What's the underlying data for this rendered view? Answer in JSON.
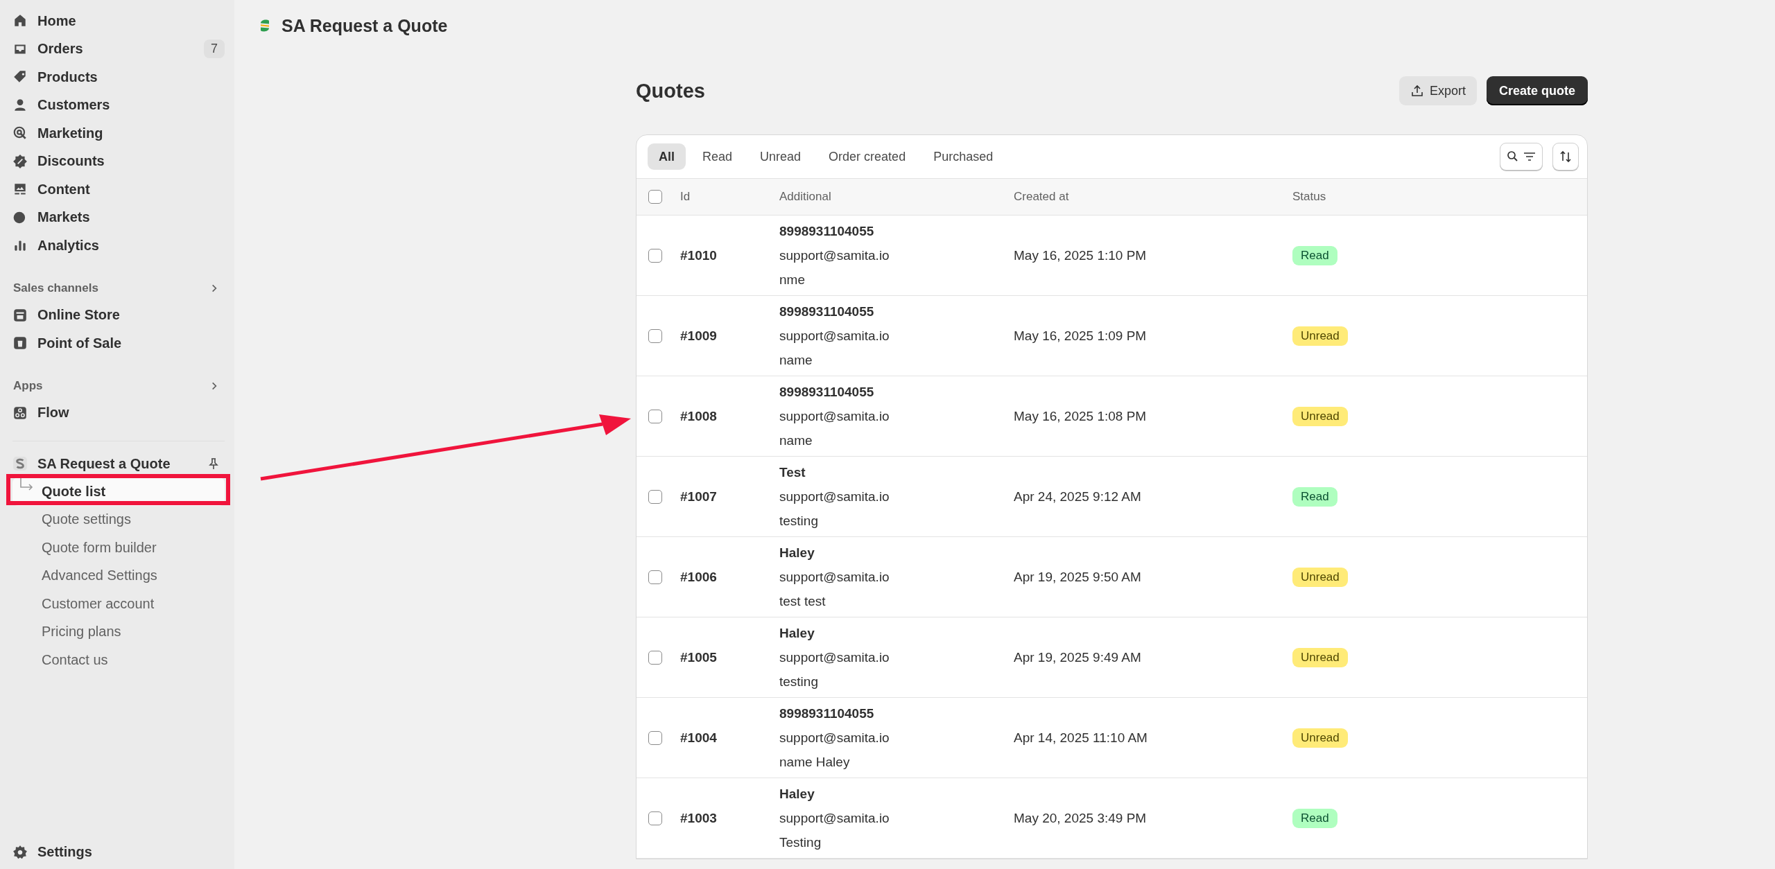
{
  "sidebar": {
    "nav": [
      {
        "label": "Home"
      },
      {
        "label": "Orders",
        "badge": "7"
      },
      {
        "label": "Products"
      },
      {
        "label": "Customers"
      },
      {
        "label": "Marketing"
      },
      {
        "label": "Discounts"
      },
      {
        "label": "Content"
      },
      {
        "label": "Markets"
      },
      {
        "label": "Analytics"
      }
    ],
    "sections": [
      {
        "title": "Sales channels",
        "items": [
          "Online Store",
          "Point of Sale"
        ]
      },
      {
        "title": "Apps",
        "items": [
          "Flow"
        ]
      }
    ],
    "app": {
      "name": "SA Request a Quote",
      "items": [
        {
          "label": "Quote list",
          "selected": true
        },
        {
          "label": "Quote settings",
          "selected": false
        },
        {
          "label": "Quote form builder",
          "selected": false
        },
        {
          "label": "Advanced Settings",
          "selected": false
        },
        {
          "label": "Customer account",
          "selected": false
        },
        {
          "label": "Pricing plans",
          "selected": false
        },
        {
          "label": "Contact us",
          "selected": false
        }
      ]
    },
    "settings": "Settings"
  },
  "topbar": {
    "title": "SA Request a Quote"
  },
  "page": {
    "title": "Quotes",
    "export_button": "Export",
    "create_button": "Create quote"
  },
  "tabs": [
    {
      "label": "All",
      "selected": true
    },
    {
      "label": "Read",
      "selected": false
    },
    {
      "label": "Unread",
      "selected": false
    },
    {
      "label": "Order created",
      "selected": false
    },
    {
      "label": "Purchased",
      "selected": false
    }
  ],
  "table": {
    "columns": [
      "Id",
      "Additional",
      "Created at",
      "Status"
    ],
    "header_checked": false,
    "rows": [
      {
        "checked": false,
        "id": "#1010",
        "additional": [
          "8998931104055",
          "support@samita.io",
          "nme"
        ],
        "created_at": "May 16, 2025 1:10 PM",
        "status": {
          "label": "Read",
          "kind": "read"
        }
      },
      {
        "checked": false,
        "id": "#1009",
        "additional": [
          "8998931104055",
          "support@samita.io",
          "name"
        ],
        "created_at": "May 16, 2025 1:09 PM",
        "status": {
          "label": "Unread",
          "kind": "unread"
        }
      },
      {
        "checked": false,
        "id": "#1008",
        "additional": [
          "8998931104055",
          "support@samita.io",
          "name"
        ],
        "created_at": "May 16, 2025 1:08 PM",
        "status": {
          "label": "Unread",
          "kind": "unread"
        }
      },
      {
        "checked": false,
        "id": "#1007",
        "additional": [
          "Test",
          "support@samita.io",
          "testing"
        ],
        "created_at": "Apr 24, 2025 9:12 AM",
        "status": {
          "label": "Read",
          "kind": "read"
        }
      },
      {
        "checked": false,
        "id": "#1006",
        "additional": [
          "Haley",
          "support@samita.io",
          "test test"
        ],
        "created_at": "Apr 19, 2025 9:50 AM",
        "status": {
          "label": "Unread",
          "kind": "unread"
        }
      },
      {
        "checked": false,
        "id": "#1005",
        "additional": [
          "Haley",
          "support@samita.io",
          "testing"
        ],
        "created_at": "Apr 19, 2025 9:49 AM",
        "status": {
          "label": "Unread",
          "kind": "unread"
        }
      },
      {
        "checked": false,
        "id": "#1004",
        "additional": [
          "8998931104055",
          "support@samita.io",
          "name Haley"
        ],
        "created_at": "Apr 14, 2025 11:10 AM",
        "status": {
          "label": "Unread",
          "kind": "unread"
        }
      },
      {
        "checked": false,
        "id": "#1003",
        "additional": [
          "Haley",
          "support@samita.io",
          "Testing"
        ],
        "created_at": "May 20, 2025 3:49 PM",
        "status": {
          "label": "Read",
          "kind": "read"
        }
      }
    ]
  }
}
